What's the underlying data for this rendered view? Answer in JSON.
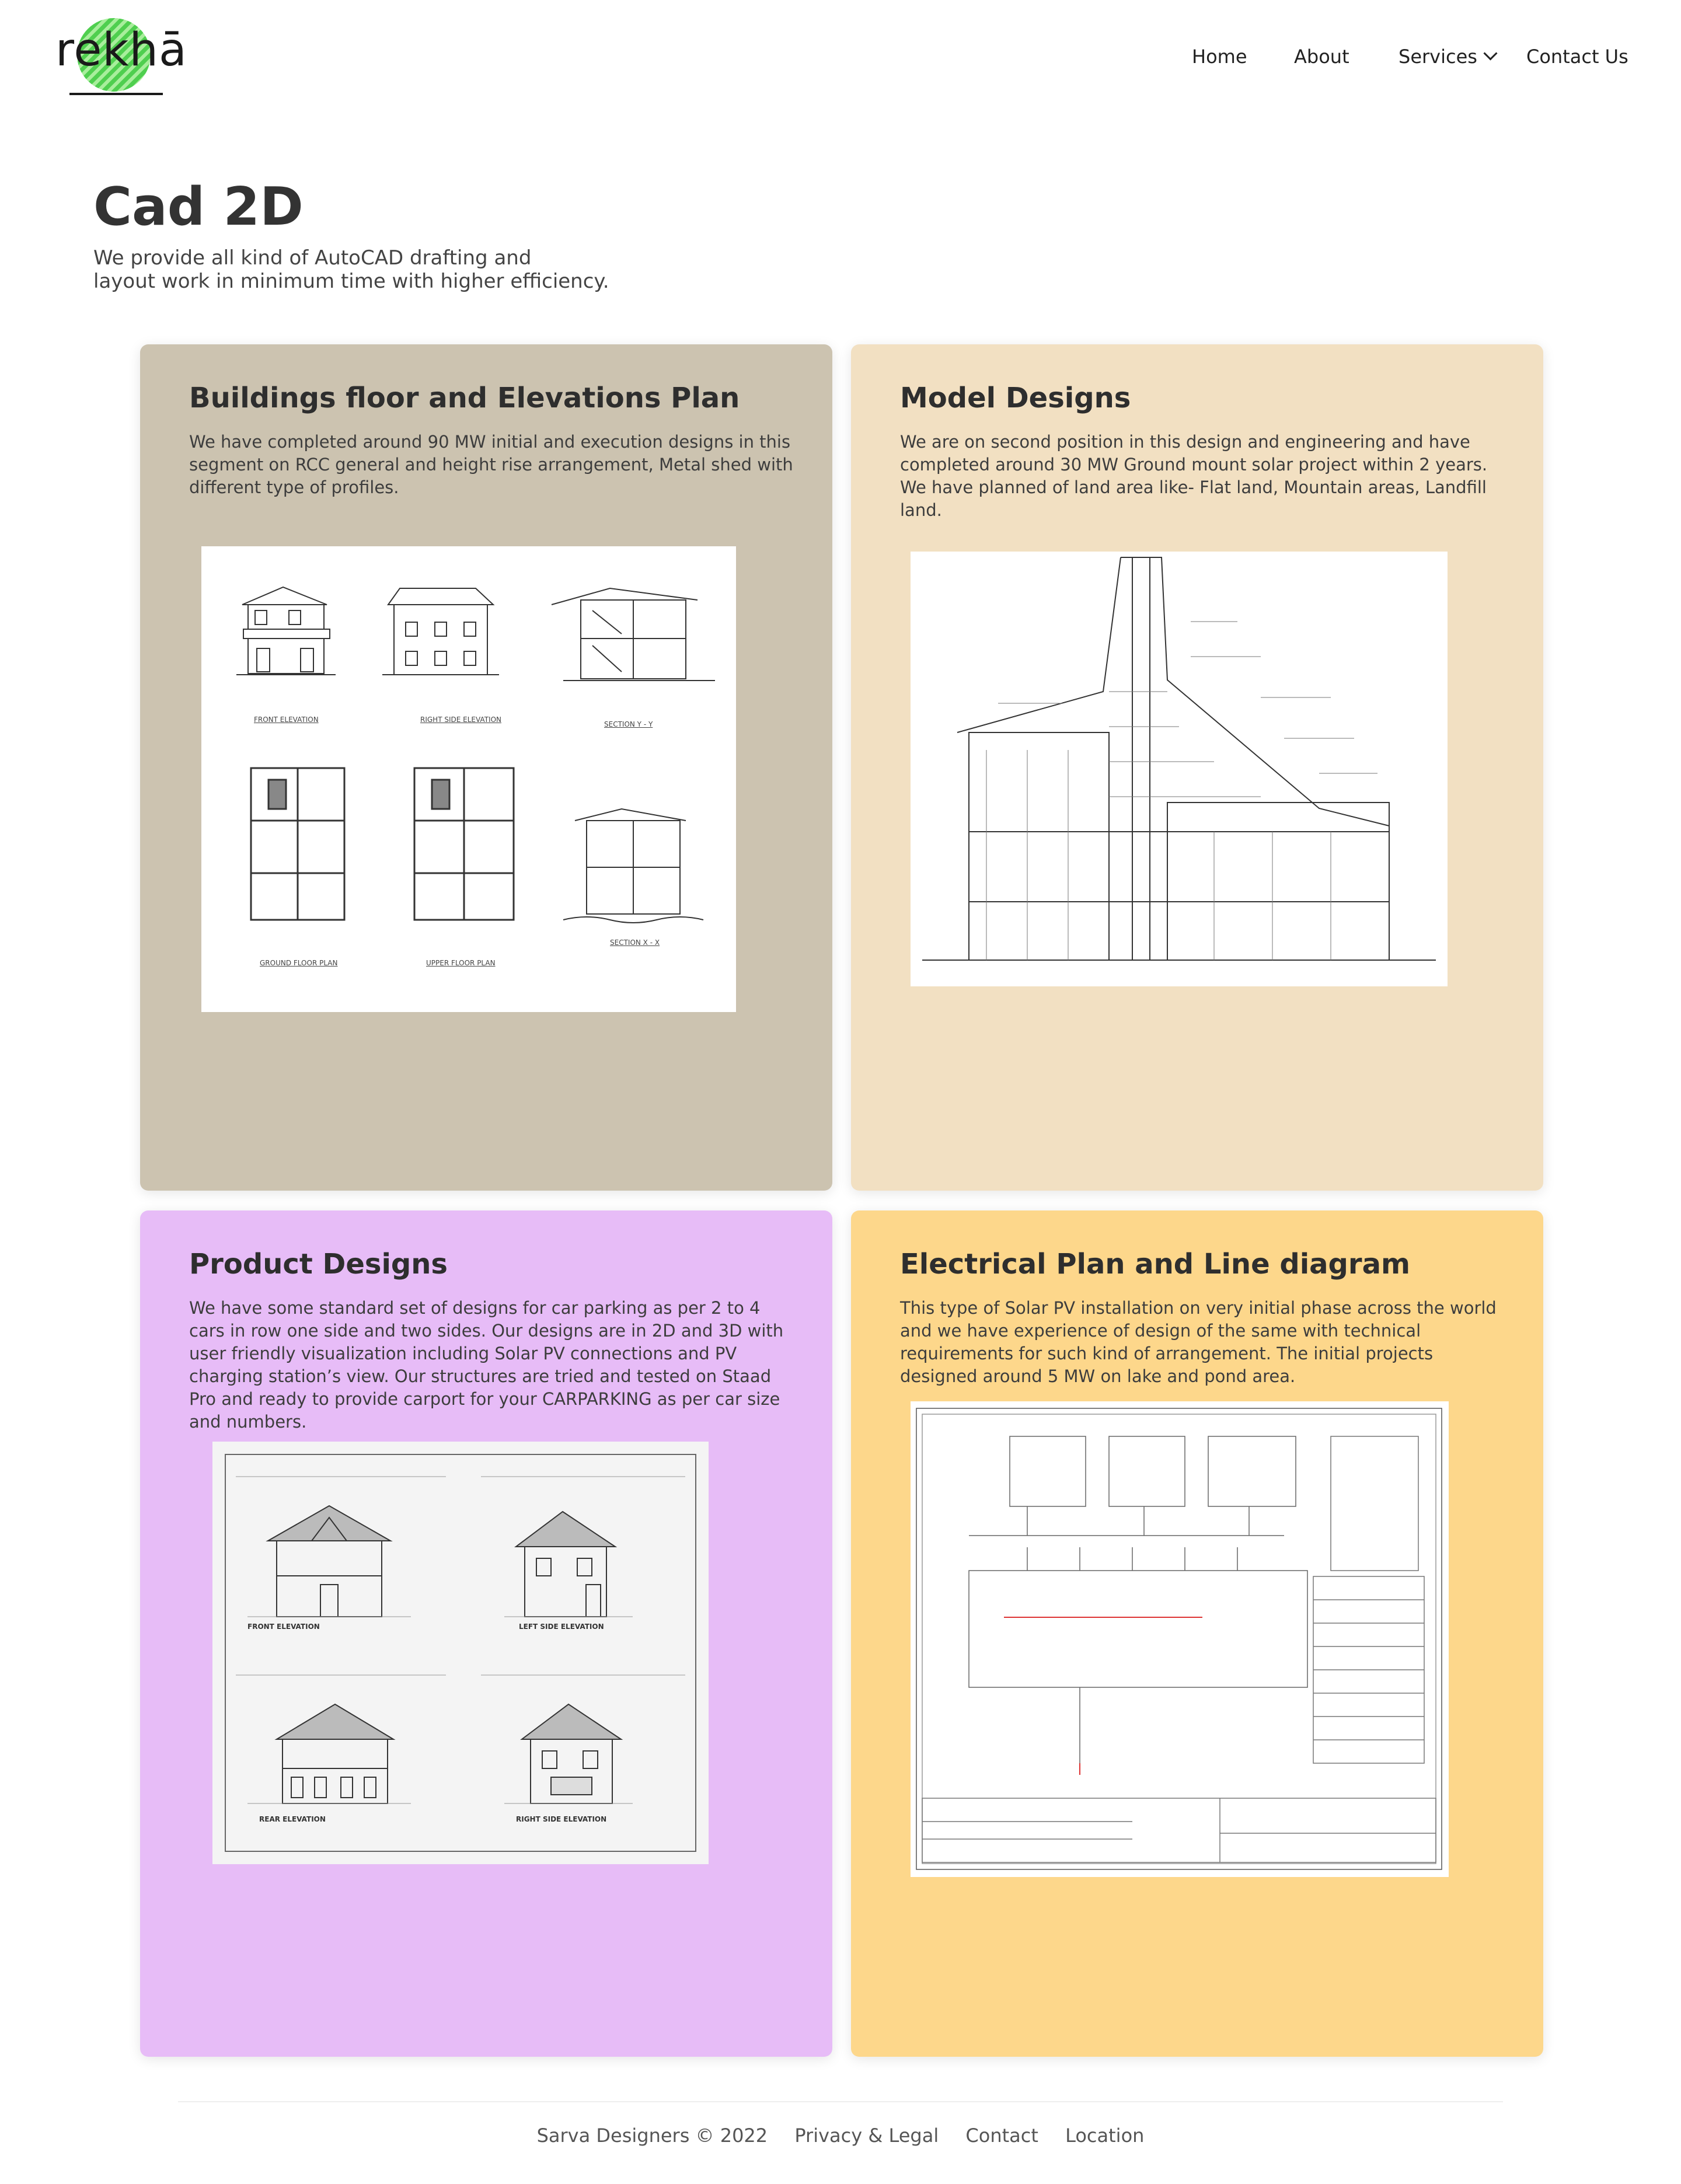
{
  "logo": {
    "text": "rekhā"
  },
  "nav": {
    "home": "Home",
    "about": "About",
    "services": "Services",
    "contact": "Contact Us"
  },
  "hero": {
    "title": "Cad 2D",
    "subtitle_line1": "We provide all kind of AutoCAD drafting and",
    "subtitle_line2": "layout work in minimum time with higher efficiency."
  },
  "cards": [
    {
      "title": "Buildings floor and Elevations Plan",
      "lines": [
        "We have completed around 90 MW initial and execution designs in this",
        "segment on RCC general and height rise arrangement, Metal shed with",
        "different type of profiles."
      ],
      "bg": "#ccc3b0",
      "captions": [
        "FRONT ELEVATION",
        "RIGHT SIDE ELEVATION",
        "SECTION Y - Y",
        "GROUND FLOOR PLAN",
        "UPPER FLOOR PLAN",
        "SECTION X - X"
      ]
    },
    {
      "title": "Model Designs",
      "lines": [
        "We are on second position in this design and engineering and have",
        "completed around 30 MW Ground mount solar project within 2 years.",
        "We have planned of land area like- Flat land, Mountain areas, Landfill",
        "land."
      ],
      "bg": "#f2e0c2"
    },
    {
      "title": "Product Designs",
      "lines": [
        "We have some standard set of designs for car parking as per 2 to 4",
        "cars in row one side and two sides. Our designs are in 2D and 3D with",
        "user friendly visualization including Solar PV connections and PV",
        "charging station’s view. Our structures are tried and tested on Staad",
        "Pro and ready to provide carport for your CARPARKING as per car size",
        "and numbers."
      ],
      "bg": "#e7bcf7",
      "captions": [
        "FRONT ELEVATION",
        "LEFT SIDE ELEVATION",
        "REAR ELEVATION",
        "RIGHT SIDE ELEVATION"
      ]
    },
    {
      "title": "Electrical Plan and Line diagram",
      "lines": [
        "This type of Solar PV installation on very initial phase across the world",
        "and we have experience of design of the same with technical",
        "requirements for such kind of arrangement. The initial projects",
        "designed around 5 MW on lake and pond area."
      ],
      "bg": "#fdd78b"
    }
  ],
  "footer": {
    "copyright": "Sarva Designers © 2022",
    "privacy": "Privacy & Legal",
    "contact": "Contact",
    "location": "Location"
  }
}
